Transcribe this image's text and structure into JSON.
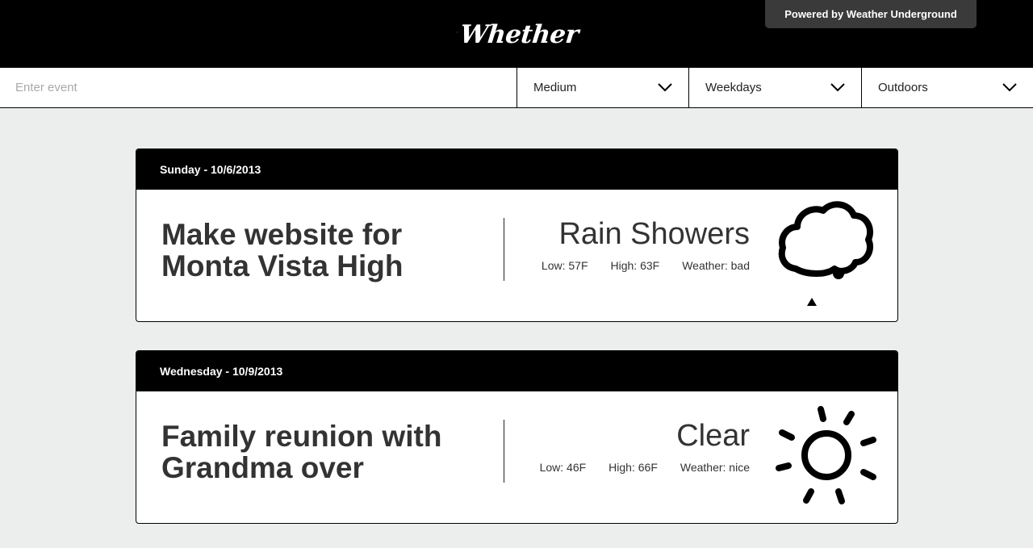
{
  "header": {
    "logo_text": "Whether",
    "powered_by": "Powered by Weather Underground"
  },
  "filters": {
    "event_placeholder": "Enter event",
    "event_value": "",
    "intensity": "Medium",
    "days": "Weekdays",
    "location": "Outdoors"
  },
  "events": [
    {
      "date": "Sunday - 10/6/2013",
      "title": "Make website for Monta Vista High",
      "condition": "Rain Showers",
      "low": "Low: 57F",
      "high": "High: 63F",
      "weather": "Weather: bad",
      "icon": "cloud-icon"
    },
    {
      "date": "Wednesday - 10/9/2013",
      "title": "Family reunion with Grandma over",
      "condition": "Clear",
      "low": "Low: 46F",
      "high": "High: 66F",
      "weather": "Weather: nice",
      "icon": "sun-icon"
    }
  ]
}
